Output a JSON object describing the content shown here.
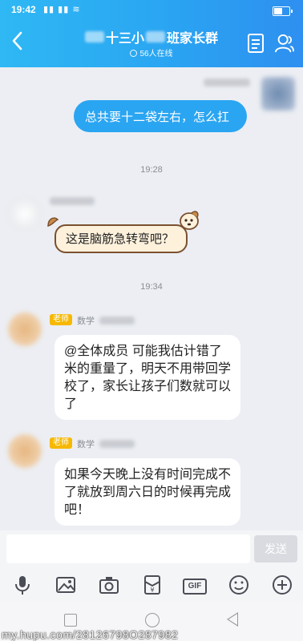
{
  "status_bar": {
    "time": "19:42",
    "signal": "▮▮ ▮▮ ≋"
  },
  "header": {
    "title_prefix": "十三小",
    "title_suffix": "班家长群",
    "online": "56人在线"
  },
  "messages": [
    {
      "type": "out",
      "text": "总共要十二袋左右，怎么扛"
    },
    {
      "type": "time",
      "text": "19:28"
    },
    {
      "type": "in_sticker",
      "text": "这是脑筋急转弯吧？"
    },
    {
      "type": "time",
      "text": "19:34"
    },
    {
      "type": "in",
      "tag": "老师",
      "sender_subject": "数学",
      "text": "@全体成员 可能我估计错了米的重量了，明天不用带回学校了，家长让孩子们数就可以了"
    },
    {
      "type": "in",
      "tag": "老师",
      "sender_subject": "数学",
      "text": "如果今天晚上没有时间完成不了就放到周六日的时候再完成吧！"
    }
  ],
  "input": {
    "value": "",
    "placeholder": "",
    "send_label": "发送"
  },
  "toolbar": {
    "items": [
      "microphone-icon",
      "image-icon",
      "camera-icon",
      "red-packet-icon",
      "gif-icon",
      "emoji-icon",
      "plus-icon"
    ],
    "gif_label": "GIF"
  },
  "watermark": "my.hupu.com/28126798O287982",
  "colors": {
    "accent": "#2aa5f2",
    "tag": "#f6b800"
  }
}
